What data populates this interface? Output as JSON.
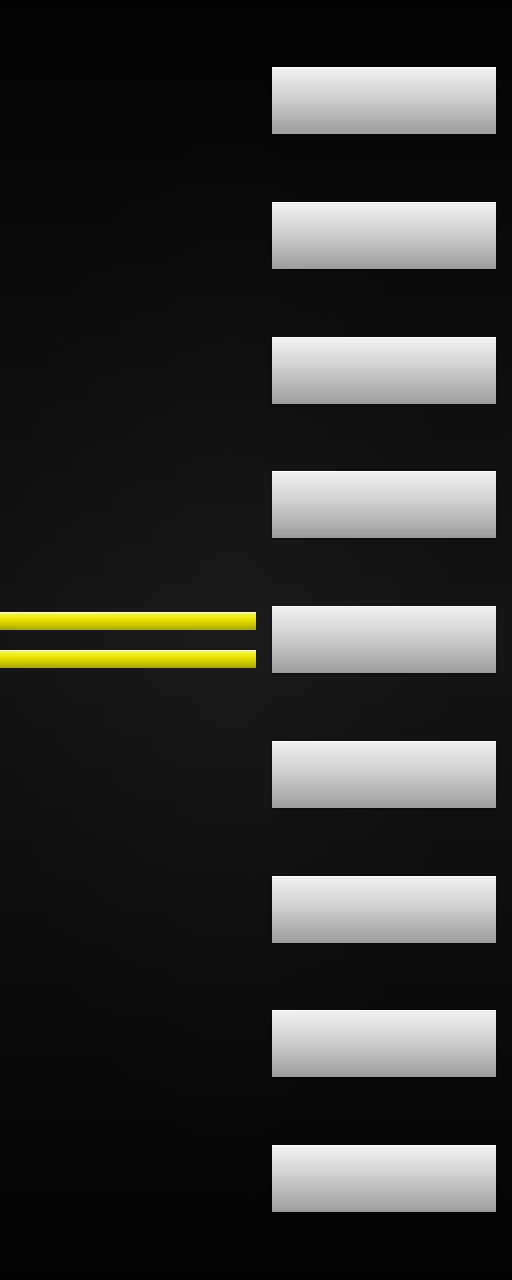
{
  "game": {
    "slots": [
      {
        "id": "slot-1"
      },
      {
        "id": "slot-2"
      },
      {
        "id": "slot-3"
      },
      {
        "id": "slot-4"
      },
      {
        "id": "slot-5"
      },
      {
        "id": "slot-6"
      },
      {
        "id": "slot-7"
      },
      {
        "id": "slot-8"
      },
      {
        "id": "slot-9"
      }
    ],
    "marker": {
      "line_count": 2,
      "aligned_slot_index": 5
    },
    "colors": {
      "background": "#111111",
      "slot_light": "#f2f2f2",
      "slot_dark": "#9c9c9c",
      "marker": "#e8e400"
    }
  }
}
